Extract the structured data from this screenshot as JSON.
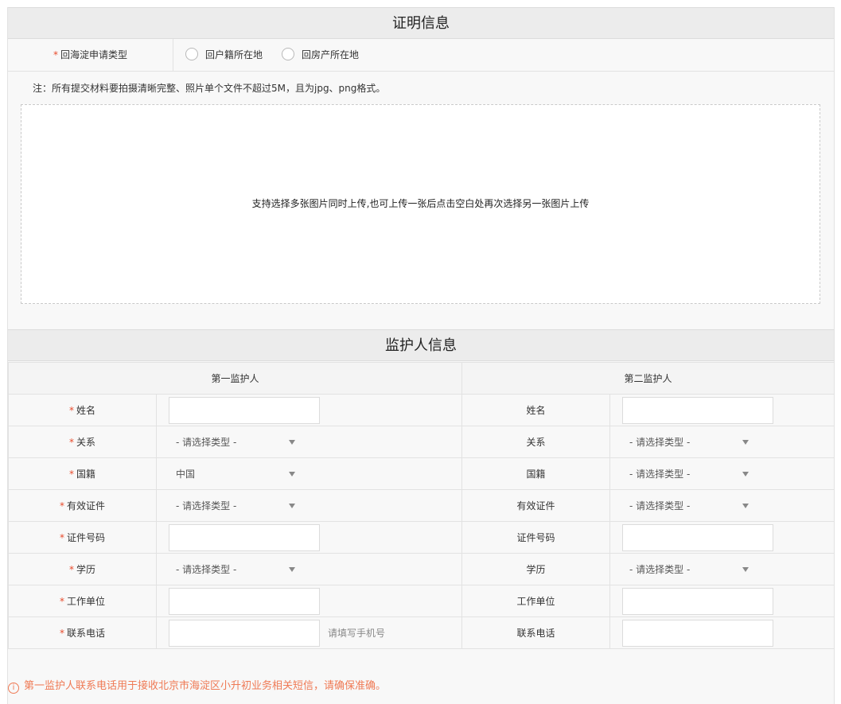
{
  "proof": {
    "title": "证明信息",
    "type_label": "回海淀申请类型",
    "options": [
      "回户籍所在地",
      "回房产所在地"
    ],
    "note": "注：所有提交材料要拍摄清晰完整、照片单个文件不超过5M，且为jpg、png格式。",
    "upload_text": "支持选择多张图片同时上传,也可上传一张后点击空白处再次选择另一张图片上传"
  },
  "guardian": {
    "title": "监护人信息",
    "first_header": "第一监护人",
    "second_header": "第二监护人",
    "labels": {
      "name": "姓名",
      "relation": "关系",
      "nationality": "国籍",
      "id_type": "有效证件",
      "id_number": "证件号码",
      "education": "学历",
      "employer": "工作单位",
      "phone": "联系电话"
    },
    "first": {
      "relation": "- 请选择类型 -",
      "nationality": "中国",
      "id_type": "- 请选择类型 -",
      "education": "- 请选择类型 -",
      "phone_hint": "请填写手机号"
    },
    "second": {
      "relation": "- 请选择类型 -",
      "nationality": "- 请选择类型 -",
      "id_type": "- 请选择类型 -",
      "education": "- 请选择类型 -"
    },
    "required_mark": "*",
    "warning": "第一监护人联系电话用于接收北京市海淀区小升初业务相关短信，请确保准确。",
    "warning_icon": "info-circle-icon"
  }
}
